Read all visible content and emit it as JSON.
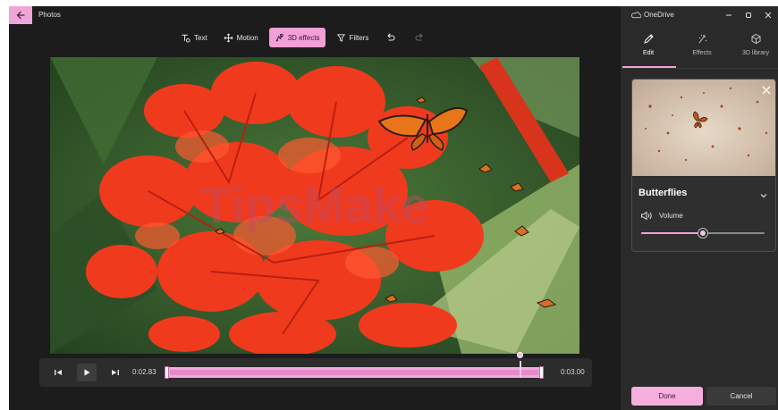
{
  "window": {
    "app_title": "Photos",
    "back_icon": "arrow-left-icon"
  },
  "toolbar": {
    "items": [
      {
        "label": "Text",
        "icon": "text-icon"
      },
      {
        "label": "Motion",
        "icon": "motion-icon"
      },
      {
        "label": "3D effects",
        "icon": "3d-effects-icon",
        "active": true
      },
      {
        "label": "Filters",
        "icon": "filters-icon"
      }
    ],
    "undo_icon": "undo-icon",
    "redo_icon": "redo-icon"
  },
  "video": {
    "watermark": "TipsMake"
  },
  "timeline": {
    "current_time": "0:02.83",
    "end_time": "0:03.00",
    "playhead_fraction": 0.94
  },
  "panel": {
    "titlebar_label": "OneDrive",
    "tabs": [
      {
        "label": "Edit",
        "icon": "pencil-icon",
        "active": true
      },
      {
        "label": "Effects",
        "icon": "effects-icon"
      },
      {
        "label": "3D library",
        "icon": "cube-icon"
      }
    ],
    "effect": {
      "name": "Butterflies",
      "volume_label": "Volume",
      "volume_fraction": 0.5
    },
    "done_label": "Done",
    "cancel_label": "Cancel"
  },
  "colors": {
    "accent": "#f29fd6",
    "panel_bg": "#2a2a2a",
    "app_bg": "#1c1c1c"
  }
}
